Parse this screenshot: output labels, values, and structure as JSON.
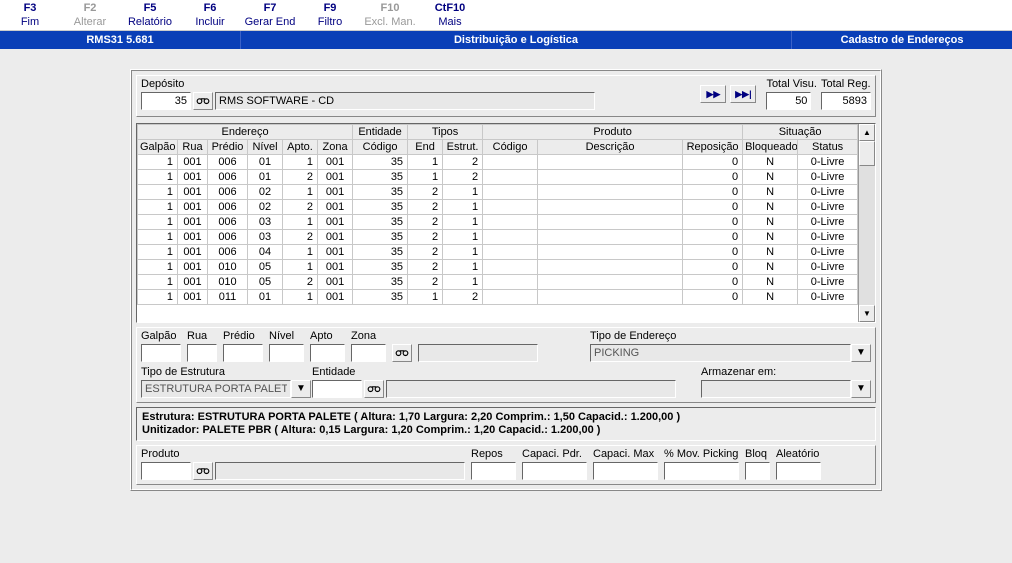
{
  "fkeys": [
    {
      "key": "F3",
      "label": "Fim",
      "disabled": false
    },
    {
      "key": "F2",
      "label": "Alterar",
      "disabled": true
    },
    {
      "key": "F5",
      "label": "Relatório",
      "disabled": false
    },
    {
      "key": "F6",
      "label": "Incluir",
      "disabled": false
    },
    {
      "key": "F7",
      "label": "Gerar End",
      "disabled": false
    },
    {
      "key": "F9",
      "label": "Filtro",
      "disabled": false
    },
    {
      "key": "F10",
      "label": "Excl. Man.",
      "disabled": true
    },
    {
      "key": "CtF10",
      "label": "Mais",
      "disabled": false
    }
  ],
  "titlebar": {
    "left": "RMS31 5.681",
    "mid": "Distribuição e Logística",
    "right": "Cadastro de Endereços"
  },
  "deposito": {
    "label": "Depósito",
    "code": "35",
    "name": "RMS SOFTWARE - CD",
    "total_visu_label": "Total Visu.",
    "total_visu": "50",
    "total_reg_label": "Total Reg.",
    "total_reg": "5893"
  },
  "grid": {
    "groups": {
      "endereco": "Endereço",
      "entidade": "Entidade",
      "tipos": "Tipos",
      "produto": "Produto",
      "situacao": "Situação"
    },
    "headers": {
      "galpao": "Galpão",
      "rua": "Rua",
      "predio": "Prédio",
      "nivel": "Nível",
      "apto": "Apto.",
      "zona": "Zona",
      "codigo": "Código",
      "end": "End",
      "estrut": "Estrut.",
      "pcodigo": "Código",
      "descricao": "Descrição",
      "reposicao": "Reposição",
      "bloqueado": "Bloqueado",
      "status": "Status"
    },
    "rows": [
      {
        "galpao": "1",
        "rua": "001",
        "predio": "006",
        "nivel": "01",
        "apto": "1",
        "zona": "001",
        "codigo": "35",
        "end": "1",
        "estrut": "2",
        "pcod": "",
        "desc": "",
        "repos": "0",
        "bloq": "N",
        "status": "0-Livre"
      },
      {
        "galpao": "1",
        "rua": "001",
        "predio": "006",
        "nivel": "01",
        "apto": "2",
        "zona": "001",
        "codigo": "35",
        "end": "1",
        "estrut": "2",
        "pcod": "",
        "desc": "",
        "repos": "0",
        "bloq": "N",
        "status": "0-Livre"
      },
      {
        "galpao": "1",
        "rua": "001",
        "predio": "006",
        "nivel": "02",
        "apto": "1",
        "zona": "001",
        "codigo": "35",
        "end": "2",
        "estrut": "1",
        "pcod": "",
        "desc": "",
        "repos": "0",
        "bloq": "N",
        "status": "0-Livre"
      },
      {
        "galpao": "1",
        "rua": "001",
        "predio": "006",
        "nivel": "02",
        "apto": "2",
        "zona": "001",
        "codigo": "35",
        "end": "2",
        "estrut": "1",
        "pcod": "",
        "desc": "",
        "repos": "0",
        "bloq": "N",
        "status": "0-Livre"
      },
      {
        "galpao": "1",
        "rua": "001",
        "predio": "006",
        "nivel": "03",
        "apto": "1",
        "zona": "001",
        "codigo": "35",
        "end": "2",
        "estrut": "1",
        "pcod": "",
        "desc": "",
        "repos": "0",
        "bloq": "N",
        "status": "0-Livre"
      },
      {
        "galpao": "1",
        "rua": "001",
        "predio": "006",
        "nivel": "03",
        "apto": "2",
        "zona": "001",
        "codigo": "35",
        "end": "2",
        "estrut": "1",
        "pcod": "",
        "desc": "",
        "repos": "0",
        "bloq": "N",
        "status": "0-Livre"
      },
      {
        "galpao": "1",
        "rua": "001",
        "predio": "006",
        "nivel": "04",
        "apto": "1",
        "zona": "001",
        "codigo": "35",
        "end": "2",
        "estrut": "1",
        "pcod": "",
        "desc": "",
        "repos": "0",
        "bloq": "N",
        "status": "0-Livre"
      },
      {
        "galpao": "1",
        "rua": "001",
        "predio": "010",
        "nivel": "05",
        "apto": "1",
        "zona": "001",
        "codigo": "35",
        "end": "2",
        "estrut": "1",
        "pcod": "",
        "desc": "",
        "repos": "0",
        "bloq": "N",
        "status": "0-Livre"
      },
      {
        "galpao": "1",
        "rua": "001",
        "predio": "010",
        "nivel": "05",
        "apto": "2",
        "zona": "001",
        "codigo": "35",
        "end": "2",
        "estrut": "1",
        "pcod": "",
        "desc": "",
        "repos": "0",
        "bloq": "N",
        "status": "0-Livre"
      },
      {
        "galpao": "1",
        "rua": "001",
        "predio": "011",
        "nivel": "01",
        "apto": "1",
        "zona": "001",
        "codigo": "35",
        "end": "1",
        "estrut": "2",
        "pcod": "",
        "desc": "",
        "repos": "0",
        "bloq": "N",
        "status": "0-Livre"
      }
    ]
  },
  "filters": {
    "galpao": "Galpão",
    "rua": "Rua",
    "predio": "Prédio",
    "nivel": "Nível",
    "apto": "Apto",
    "zona": "Zona",
    "tipo_end_label": "Tipo de Endereço",
    "tipo_end_value": "PICKING",
    "tipo_estr_label": "Tipo de Estrutura",
    "tipo_estr_value": "ESTRUTURA PORTA PALETE",
    "entidade_label": "Entidade",
    "armazenar_label": "Armazenar em:"
  },
  "info": {
    "line1": "Estrutura: ESTRUTURA PORTA PALETE ( Altura: 1,70  Largura: 2,20  Comprim.: 1,50  Capacid.: 1.200,00 )",
    "line2": "Unitizador: PALETE PBR ( Altura: 0,15  Largura: 1,20  Comprim.: 1,20  Capacid.: 1.200,00 )"
  },
  "bottom": {
    "produto": "Produto",
    "repos": "Repos",
    "cap_pdr": "Capaci. Pdr.",
    "cap_max": "Capaci. Max",
    "mov": "% Mov. Picking",
    "bloq": "Bloq",
    "aleat": "Aleatório"
  },
  "icons": {
    "binoc": "🔍",
    "next": "▶▶",
    "last": "▶▶|"
  }
}
